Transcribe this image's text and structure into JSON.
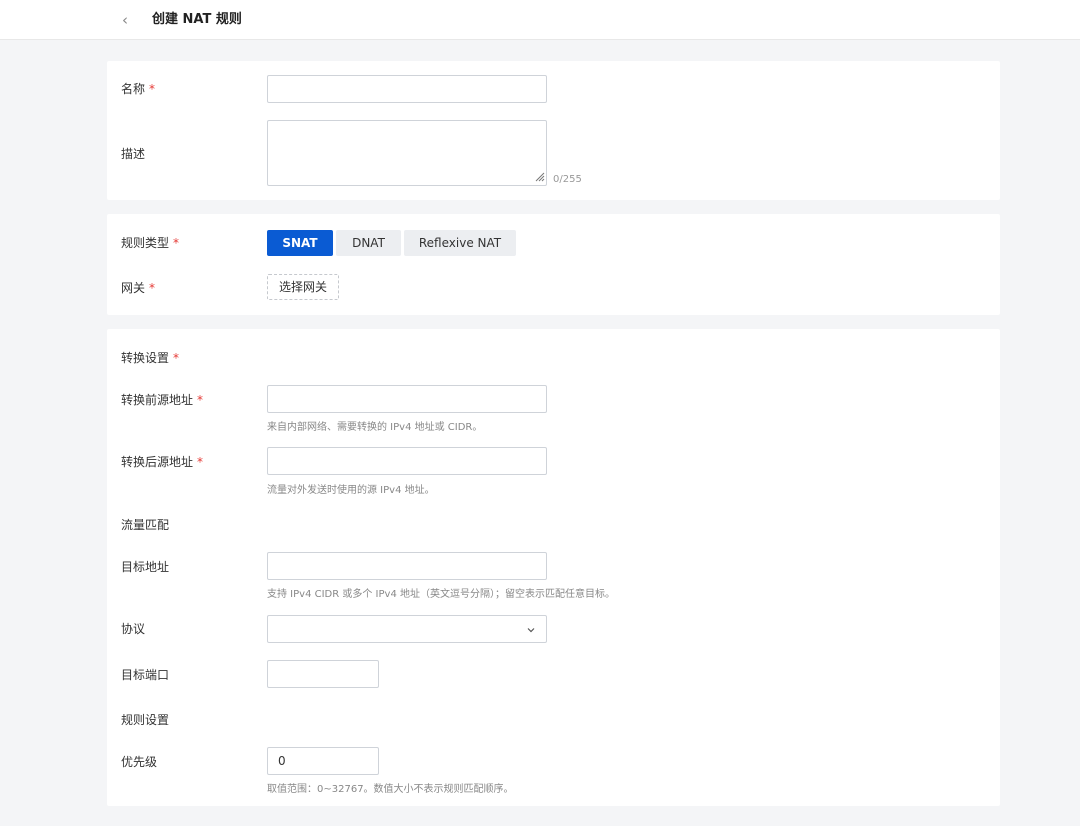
{
  "header": {
    "title": "创建 NAT 规则"
  },
  "basic": {
    "name_label": "名称",
    "name_value": "",
    "desc_label": "描述",
    "desc_value": "",
    "desc_counter": "0/255"
  },
  "rule": {
    "type_label": "规则类型",
    "types": [
      "SNAT",
      "DNAT",
      "Reflexive NAT"
    ],
    "selected_type": "SNAT",
    "gateway_label": "网关",
    "gateway_button": "选择网关"
  },
  "translation": {
    "section_label": "转换设置",
    "src_before_label": "转换前源地址",
    "src_before_value": "",
    "src_before_hint": "来自内部网络、需要转换的 IPv4 地址或 CIDR。",
    "src_after_label": "转换后源地址",
    "src_after_value": "",
    "src_after_hint": "流量对外发送时使用的源 IPv4 地址。",
    "match_label": "流量匹配",
    "dest_label": "目标地址",
    "dest_value": "",
    "dest_hint": "支持 IPv4 CIDR 或多个 IPv4 地址（英文逗号分隔）；留空表示匹配任意目标。",
    "protocol_label": "协议",
    "protocol_value": "",
    "port_label": "目标端口",
    "port_value": "",
    "rule_settings_label": "规则设置",
    "priority_label": "优先级",
    "priority_value": "0",
    "priority_hint": "取值范围：0~32767。数值大小不表示规则匹配顺序。"
  },
  "required_mark": "*",
  "colors": {
    "accent": "#0a5bd3",
    "required": "#e53935",
    "background": "#f4f5f7"
  }
}
